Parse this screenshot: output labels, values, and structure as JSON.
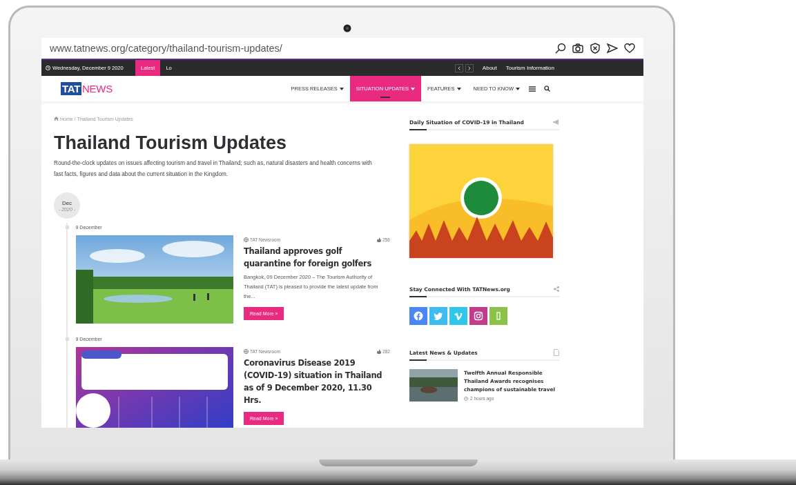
{
  "browser": {
    "url": "www.tatnews.org/category/thailand-tourism-updates/"
  },
  "top_bar": {
    "date": "Wednesday, December 9 2020",
    "ticker_label": "Latest",
    "ticker_text": "Lo",
    "links": [
      "About",
      "Tourism Information"
    ]
  },
  "nav": {
    "logo": {
      "primary": "TAT",
      "secondary": "NEWS"
    },
    "items": [
      {
        "label": "PRESS RELEASES",
        "selected": false
      },
      {
        "label": "SITUATION UPDATES",
        "selected": true
      },
      {
        "label": "FEATURES",
        "selected": false
      },
      {
        "label": "NEED TO KNOW",
        "selected": false
      }
    ]
  },
  "breadcrumb": {
    "items": [
      "Home",
      "Thailand Tourism Updates"
    ],
    "separator": "/"
  },
  "page": {
    "title": "Thailand Tourism Updates",
    "description": "Round-the-clock updates on issues affecting tourism and travel in Thailand; such as, natural disasters and health concerns with fast facts, figures and data about the current situation in the Kingdom."
  },
  "timeline": {
    "month": "Dec",
    "year": "- 2020 -"
  },
  "posts": [
    {
      "date_label": "9 December",
      "kind": "photo",
      "author": "TAT Newsroom",
      "views": "256",
      "title": "Thailand approves golf quarantine for foreign golfers",
      "excerpt": "Bangkok, 09 December 2020 – The Tourism Authority of Thailand (TAT) is pleased to provide the latest update from the...",
      "button": "Read More »"
    },
    {
      "date_label": "9 December",
      "kind": "infographic",
      "author": "TAT Newsroom",
      "views": "282",
      "title": "Coronavirus Disease 2019 (COVID-19) situation in Thailand as of 9 December 2020, 11.30 Hrs.",
      "button": "Read More »"
    }
  ],
  "sidebar": {
    "widgets": [
      {
        "kind": "image",
        "title": "Daily Situation of COVID-19 in Thailand"
      },
      {
        "kind": "social",
        "title": "Stay Connected With TATNews.org",
        "buttons": [
          {
            "kind": "facebook",
            "color": "#4a86f7"
          },
          {
            "kind": "twitter",
            "color": "#3ebbf0"
          },
          {
            "kind": "vimeo",
            "color": "#2ec6ea"
          },
          {
            "kind": "instagram",
            "color": "#c33b8d"
          },
          {
            "kind": "other",
            "color": "#8bc34a"
          }
        ]
      },
      {
        "kind": "news",
        "title": "Latest News & Updates",
        "items": [
          {
            "title": "Twelfth Annual Responsible Thailand Awards recognises champions of sustainable travel",
            "time": "2 hours ago"
          }
        ]
      }
    ]
  }
}
